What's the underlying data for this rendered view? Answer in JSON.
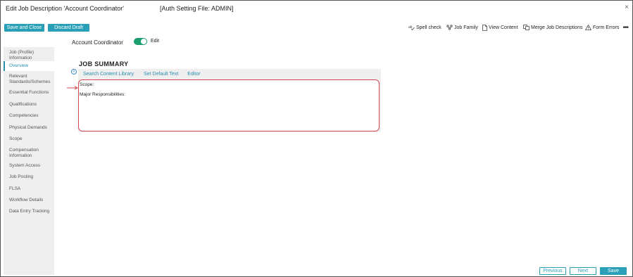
{
  "window": {
    "title": "Edit Job Description 'Account Coordinator'",
    "auth": "[Auth Setting File: ADMIN]",
    "close_glyph": "×"
  },
  "toolbar": {
    "save_close": "Save and Close",
    "discard": "Discard Draft",
    "tools": [
      {
        "label": "Spell check",
        "icon": "spellcheck-icon"
      },
      {
        "label": "Job Family",
        "icon": "job-family-icon"
      },
      {
        "label": "View Content",
        "icon": "document-icon"
      },
      {
        "label": "Merge Job Descriptions",
        "icon": "merge-icon"
      },
      {
        "label": "Form Errors",
        "icon": "warning-icon"
      }
    ],
    "more": "•••"
  },
  "header": {
    "job_title": "Account Coordinator",
    "toggle_label": "Edit",
    "toggle_on": true
  },
  "sidebar": {
    "items": [
      {
        "label": "Job (Profile) Information",
        "active": false
      },
      {
        "label": "Overview",
        "active": true
      },
      {
        "label": "Relevant Standards/Schemes",
        "active": false
      },
      {
        "label": "Essential Functions",
        "active": false
      },
      {
        "label": "Qualifications",
        "active": false
      },
      {
        "label": "Competencies",
        "active": false
      },
      {
        "label": "Physical Demands",
        "active": false
      },
      {
        "label": "Scope",
        "active": false
      },
      {
        "label": "Compensation Information",
        "active": false
      },
      {
        "label": "System Access",
        "active": false
      },
      {
        "label": "Job Posting",
        "active": false
      },
      {
        "label": "FLSA",
        "active": false
      },
      {
        "label": "Workflow Details",
        "active": false
      },
      {
        "label": "Data Entry Tracking",
        "active": false
      }
    ]
  },
  "section": {
    "title": "JOB SUMMARY",
    "info": "i",
    "links": [
      "Search Content Library",
      "Set Default Text",
      "Editor"
    ],
    "content": [
      "Scope:",
      "Major Responsibilities:"
    ]
  },
  "pager": {
    "previous": "Previous",
    "next": "Next",
    "save": "Save"
  },
  "colors": {
    "accent": "#2aa0b8",
    "toggle": "#1a9e6c",
    "highlight": "#d04b50"
  }
}
